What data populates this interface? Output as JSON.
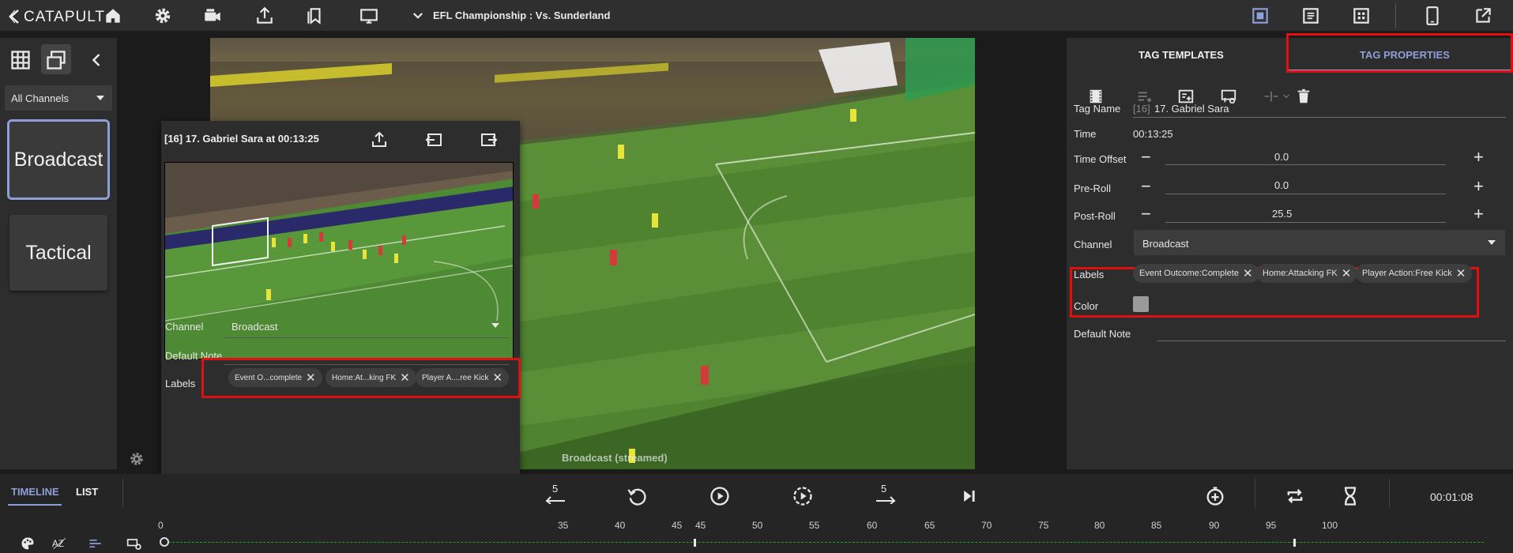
{
  "app": {
    "logo_text": "CATAPULT"
  },
  "header": {
    "match_title": "EFL Championship : Vs. Sunderland",
    "icons": [
      "home-icon",
      "gear-icon",
      "camera-icon",
      "share-icon",
      "bookmarks-icon",
      "monitor-icon",
      "chevron-down-icon",
      "layout-single-icon",
      "layout-list-icon",
      "layout-grid-icon",
      "tablet-icon",
      "open-external-icon"
    ]
  },
  "sidebar": {
    "channel_filter": "All Channels",
    "channels": [
      {
        "label": "Broadcast",
        "active": true
      },
      {
        "label": "Tactical",
        "active": false
      }
    ]
  },
  "video": {
    "caption": "Broadcast (streamed)"
  },
  "popup": {
    "title": "[16] 17. Gabriel Sara at 00:13:25",
    "channel_label": "Channel",
    "channel_value": "Broadcast",
    "default_note_label": "Default Note",
    "labels_label": "Labels",
    "labels": [
      "Event O...complete",
      "Home:At...king FK",
      "Player A....ree Kick"
    ]
  },
  "tag_panel": {
    "tabs": [
      {
        "label": "TAG TEMPLATES",
        "active": false
      },
      {
        "label": "TAG PROPERTIES",
        "active": true
      }
    ],
    "tag_name_label": "Tag Name",
    "tag_name_prefix": "[16]",
    "tag_name_value": "17. Gabriel Sara",
    "time_label": "Time",
    "time_value": "00:13:25",
    "time_offset_label": "Time Offset",
    "time_offset_value": "0.0",
    "pre_roll_label": "Pre-Roll",
    "pre_roll_value": "0.0",
    "post_roll_label": "Post-Roll",
    "post_roll_value": "25.5",
    "channel_label": "Channel",
    "channel_value": "Broadcast",
    "labels_label": "Labels",
    "labels": [
      "Event Outcome:Complete",
      "Home:Attacking FK",
      "Player Action:Free Kick"
    ],
    "color_label": "Color",
    "color_value": "#9a9a9a",
    "default_note_label": "Default Note"
  },
  "transport": {
    "tabs": [
      {
        "label": "TIMELINE",
        "active": true
      },
      {
        "label": "LIST",
        "active": false
      }
    ],
    "skip_back_label": "5",
    "skip_forward_label": "5",
    "timecode": "00:01:08",
    "ruler": [
      "0",
      "35",
      "40",
      "45",
      "45",
      "50",
      "55",
      "60",
      "65",
      "70",
      "75",
      "80",
      "85",
      "90",
      "95",
      "100"
    ]
  },
  "colors": {
    "accent": "#8e9fd8",
    "highlight": "#e01010",
    "timeline_green": "#2e9b2e"
  }
}
